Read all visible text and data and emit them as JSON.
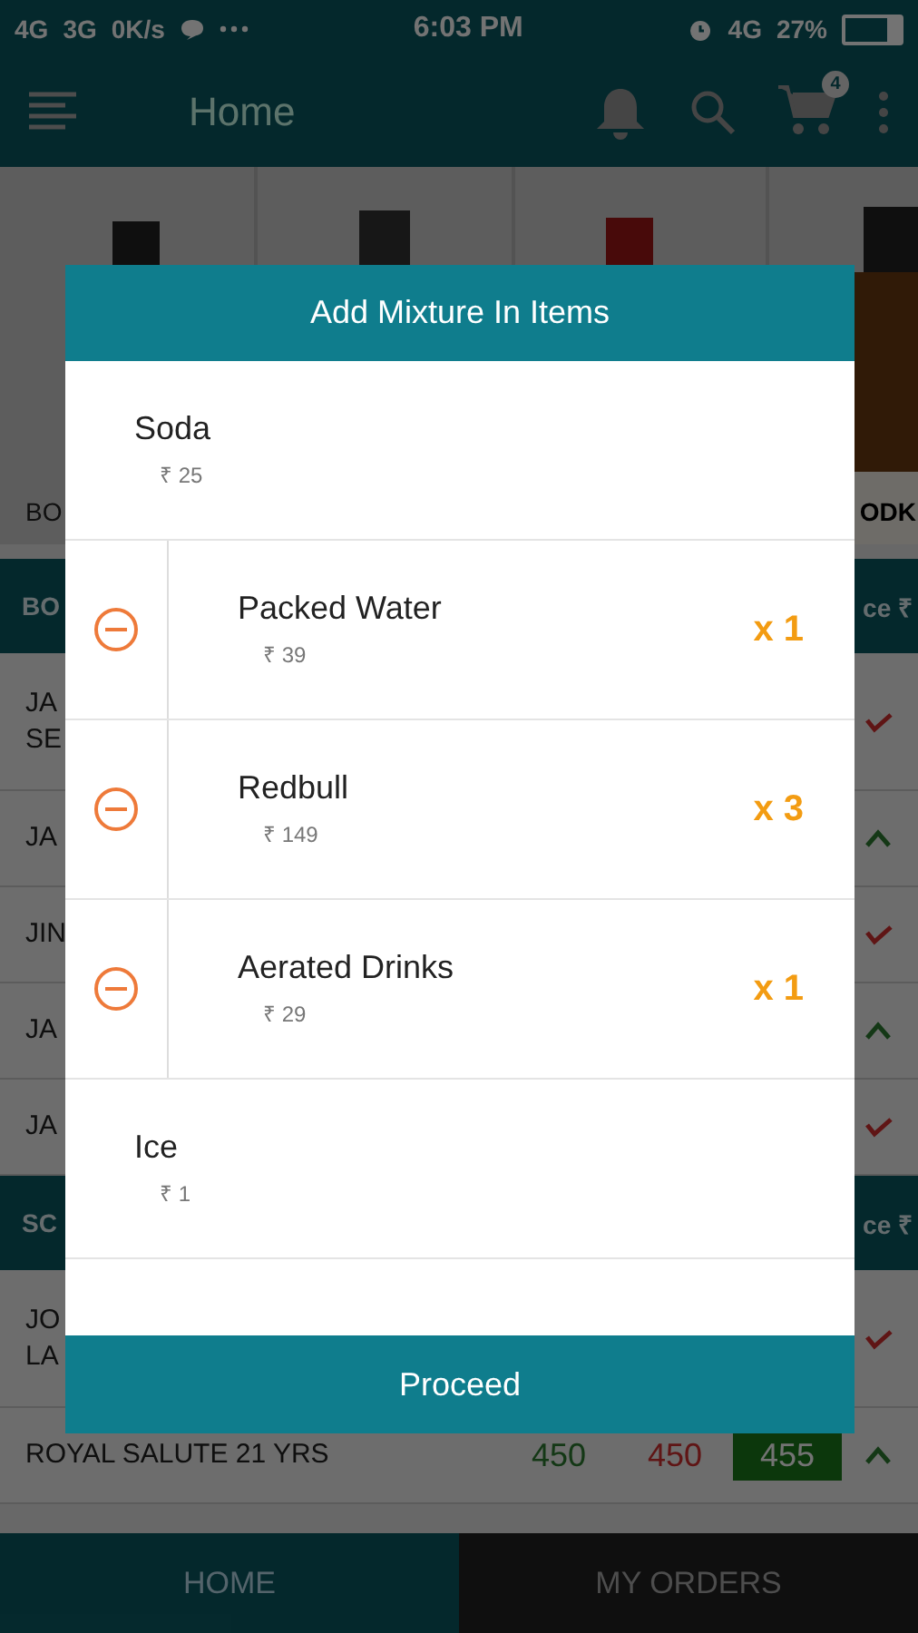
{
  "status_bar": {
    "left": [
      "4G",
      "3G",
      "0K/s"
    ],
    "time": "6:03 PM",
    "network": "4G",
    "battery": "27%"
  },
  "toolbar": {
    "title": "Home",
    "cart_count": "4"
  },
  "banner": {
    "captions": [
      "BO",
      "ODK"
    ]
  },
  "sections": [
    {
      "header": [
        "BO",
        "ce ₹"
      ],
      "rows": [
        {
          "name": "JA\nSE",
          "rising": false
        },
        {
          "name": "JA",
          "rising": true
        },
        {
          "name": "JIN",
          "rising": false
        },
        {
          "name": "JA",
          "rising": true
        },
        {
          "name": "JA",
          "rising": false
        }
      ]
    },
    {
      "header": [
        "SC",
        "ce ₹"
      ],
      "rows": [
        {
          "name": "JO\nLA",
          "rising": false
        },
        {
          "name": "ROYAL SALUTE 21 YRS",
          "prices": [
            "450",
            "450",
            "455"
          ],
          "rising": true
        }
      ]
    }
  ],
  "dialog": {
    "title": "Add Mixture In Items",
    "items": [
      {
        "kind": "plain",
        "name": "Soda",
        "price": "₹ 25"
      },
      {
        "kind": "added",
        "name": "Packed Water",
        "price": "₹ 39",
        "quantity": "x 1"
      },
      {
        "kind": "added",
        "name": "Redbull",
        "price": "₹ 149",
        "quantity": "x 3"
      },
      {
        "kind": "added",
        "name": "Aerated Drinks",
        "price": "₹ 29",
        "quantity": "x 1"
      },
      {
        "kind": "plain",
        "name": "Ice",
        "price": "₹ 1"
      }
    ],
    "button": "Proceed"
  },
  "bottom_nav": [
    {
      "label": "HOME",
      "selected": true
    },
    {
      "label": "MY ORDERS",
      "selected": false
    }
  ]
}
